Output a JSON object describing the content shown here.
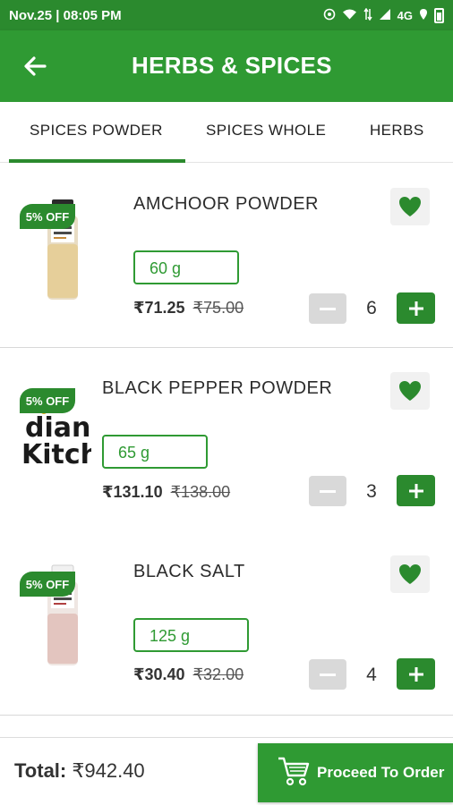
{
  "status_bar": {
    "time": "Nov.25 | 08:05 PM",
    "network": "4G"
  },
  "header": {
    "title": "HERBS & SPICES"
  },
  "tabs": [
    {
      "label": "SPICES POWDER",
      "active": true
    },
    {
      "label": "SPICES WHOLE",
      "active": false
    },
    {
      "label": "HERBS",
      "active": false
    }
  ],
  "products": [
    {
      "name": "AMCHOOR POWDER",
      "discount": "5% OFF",
      "size": "60 g",
      "price": "₹71.25",
      "mrp": "₹75.00",
      "quantity": "6",
      "favorite": true
    },
    {
      "name": "BLACK PEPPER POWDER",
      "discount": "5% OFF",
      "size": "65 g",
      "price": "₹131.10",
      "mrp": "₹138.00",
      "quantity": "3",
      "favorite": true,
      "image_text_1": "dian",
      "image_text_2": "Kitch"
    },
    {
      "name": "BLACK SALT",
      "discount": "5% OFF",
      "size": "125 g",
      "price": "₹30.40",
      "mrp": "₹32.00",
      "quantity": "4",
      "favorite": true
    }
  ],
  "footer": {
    "total_label": "Total:",
    "total_value": "₹942.40",
    "proceed_label": "Proceed To Order"
  },
  "colors": {
    "primary": "#2f9a33",
    "status_bar": "#2b8a2e",
    "disabled": "#d9d9d9"
  }
}
